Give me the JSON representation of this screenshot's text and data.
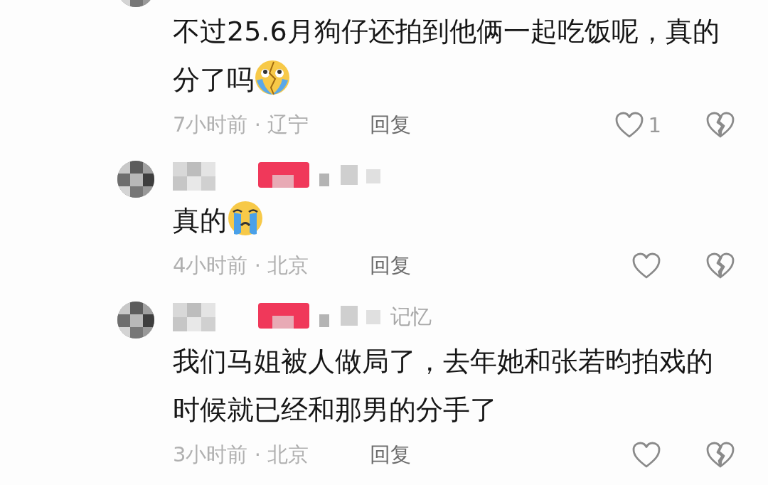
{
  "comments": [
    {
      "kind": "cut_top",
      "text": "不过25.6月狗仔还拍到他俩一起吃饭呢，真的分了吗",
      "emoji": {
        "kind": "cracked"
      },
      "time": "7小时前 · 辽宁",
      "reply": "回复",
      "likes": "1"
    },
    {
      "kind": "full",
      "text": "真的",
      "emoji": {
        "kind": "sob"
      },
      "time": "4小时前 · 北京",
      "reply": "回复"
    },
    {
      "kind": "full",
      "name_suffix": "记忆",
      "text": "我们马姐被人做局了，去年她和张若昀拍戏的时候就已经和那男的分手了",
      "time": "3小时前 · 北京",
      "reply": "回复"
    }
  ]
}
